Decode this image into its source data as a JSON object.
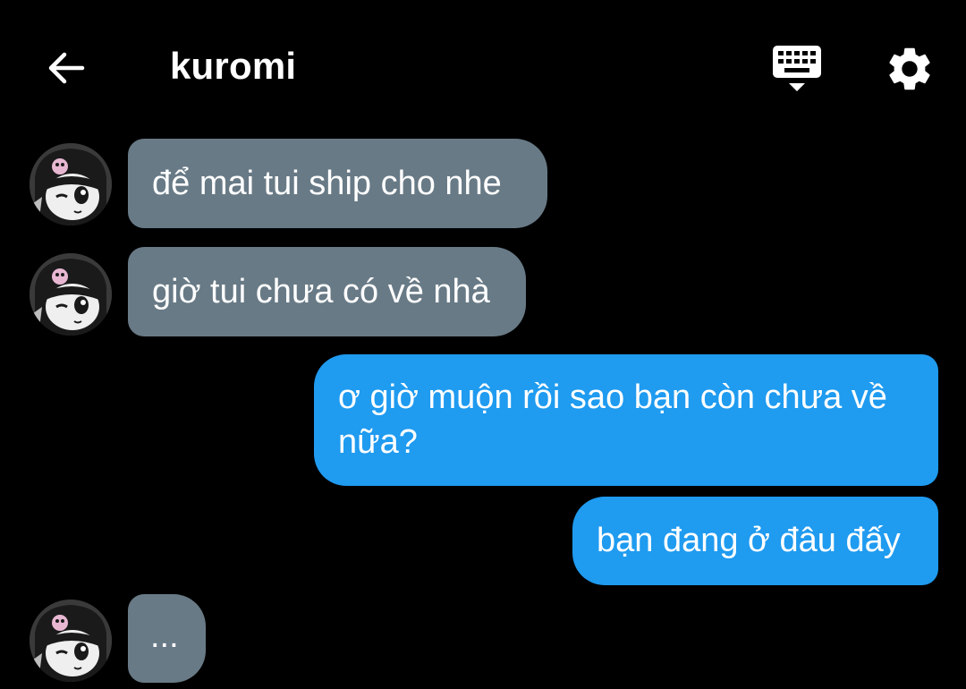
{
  "header": {
    "title": "kuromi",
    "back_icon": "arrow-left-icon",
    "keyboard_icon": "keyboard-icon",
    "settings_icon": "gear-icon"
  },
  "colors": {
    "background": "#000000",
    "incoming_bubble": "#687a86",
    "outgoing_bubble": "#1f9bf0",
    "text": "#ffffff"
  },
  "messages": [
    {
      "side": "incoming",
      "text": "để mai tui ship cho nhe"
    },
    {
      "side": "incoming",
      "text": "giờ tui chưa có về nhà"
    },
    {
      "side": "outgoing",
      "lines": [
        "ơ giờ muộn rồi sao bạn còn chưa về",
        "nữa?"
      ]
    },
    {
      "side": "outgoing",
      "text": "bạn đang ở đâu đấy"
    },
    {
      "side": "incoming",
      "text": "..."
    }
  ]
}
